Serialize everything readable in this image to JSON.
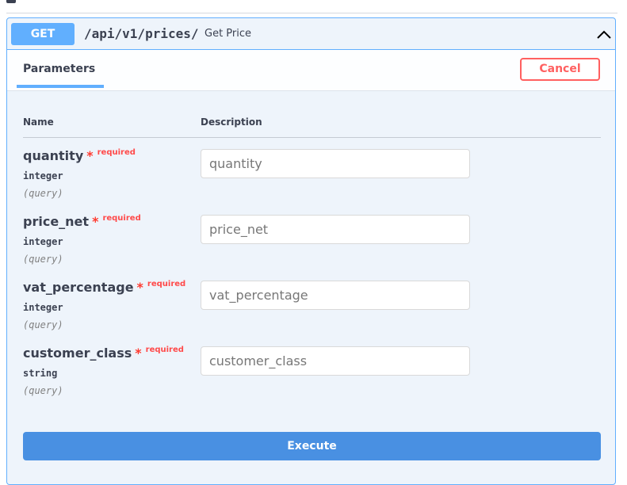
{
  "operation": {
    "method": "GET",
    "path": "/api/v1/prices/",
    "summary": "Get Price",
    "method_color": "#61affe",
    "collapse_icon": "chevron-up-icon"
  },
  "parameters": {
    "tab_label": "Parameters",
    "cancel_label": "Cancel",
    "col_name": "Name",
    "col_description": "Description",
    "rows": [
      {
        "name": "quantity",
        "required_mark": "*",
        "required_label": "required",
        "type": "integer",
        "in": "(query)",
        "placeholder": "quantity",
        "value": ""
      },
      {
        "name": "price_net",
        "required_mark": "*",
        "required_label": "required",
        "type": "integer",
        "in": "(query)",
        "placeholder": "price_net",
        "value": ""
      },
      {
        "name": "vat_percentage",
        "required_mark": "*",
        "required_label": "required",
        "type": "integer",
        "in": "(query)",
        "placeholder": "vat_percentage",
        "value": ""
      },
      {
        "name": "customer_class",
        "required_mark": "*",
        "required_label": "required",
        "type": "string",
        "in": "(query)",
        "placeholder": "customer_class",
        "value": ""
      }
    ]
  },
  "execute_label": "Execute",
  "colors": {
    "cancel": "#ff6060",
    "execute": "#4990e2",
    "required": "#ff3b30"
  }
}
